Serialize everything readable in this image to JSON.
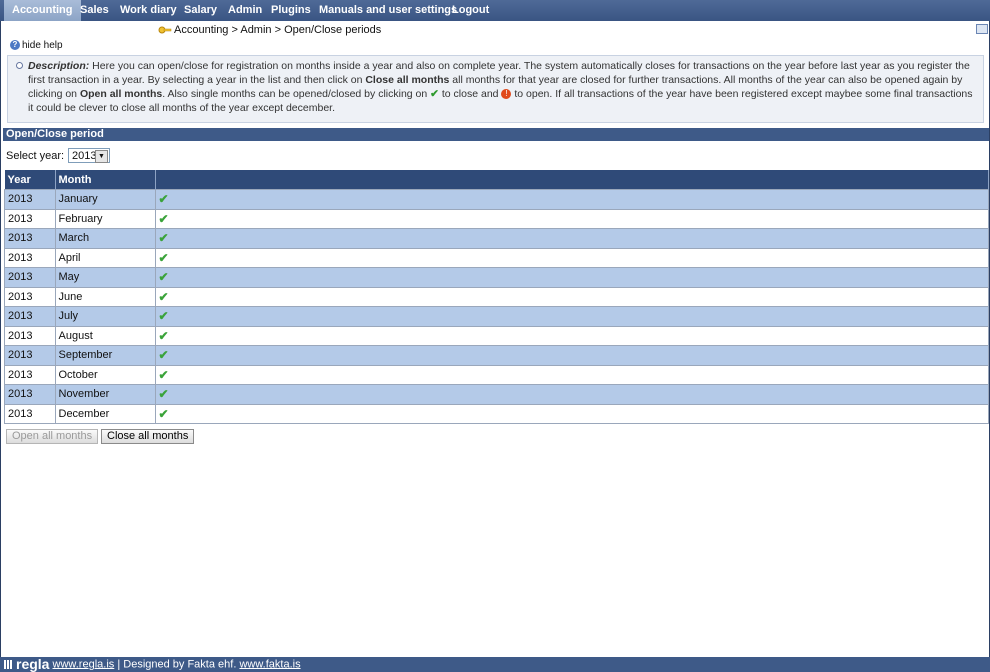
{
  "nav": {
    "items": [
      "Accounting",
      "Sales",
      "Work diary",
      "Salary",
      "Admin",
      "Plugins",
      "Manuals and user settings",
      "Logout"
    ]
  },
  "breadcrumb": "Accounting > Admin > Open/Close periods",
  "help": {
    "toggle_label": "hide help",
    "label": "Description:",
    "text_1": " Here you can open/close for registration on months inside a year and also on complete year. The system automatically closes for transactions on the year before last year as you register the first transaction in a year. By selecting a year in the list and then click on ",
    "bold_close": "Close all months",
    "text_2": " all months for that year are closed for further transactions. All months of the year can also be opened again by clicking on ",
    "bold_open": "Open all months",
    "text_3": ". Also single months can be opened/closed by clicking on ",
    "text_4": " to close and ",
    "text_5": " to open. If all transactions of the year have been registered except maybee some final transactions it could be clever to close all months of the year except december."
  },
  "section_title": "Open/Close period",
  "year_select": {
    "label": "Select year:",
    "value": "2013"
  },
  "table": {
    "headers": [
      "Year",
      "Month",
      ""
    ],
    "rows": [
      {
        "year": "2013",
        "month": "January"
      },
      {
        "year": "2013",
        "month": "February"
      },
      {
        "year": "2013",
        "month": "March"
      },
      {
        "year": "2013",
        "month": "April"
      },
      {
        "year": "2013",
        "month": "May"
      },
      {
        "year": "2013",
        "month": "June"
      },
      {
        "year": "2013",
        "month": "July"
      },
      {
        "year": "2013",
        "month": "August"
      },
      {
        "year": "2013",
        "month": "September"
      },
      {
        "year": "2013",
        "month": "October"
      },
      {
        "year": "2013",
        "month": "November"
      },
      {
        "year": "2013",
        "month": "December"
      }
    ]
  },
  "buttons": {
    "open_all": "Open all months",
    "close_all": "Close all months"
  },
  "footer": {
    "brand": "regla",
    "link1": "www.regla.is",
    "designed": " | Designed by Fakta ehf. ",
    "link2": "www.fakta.is"
  }
}
